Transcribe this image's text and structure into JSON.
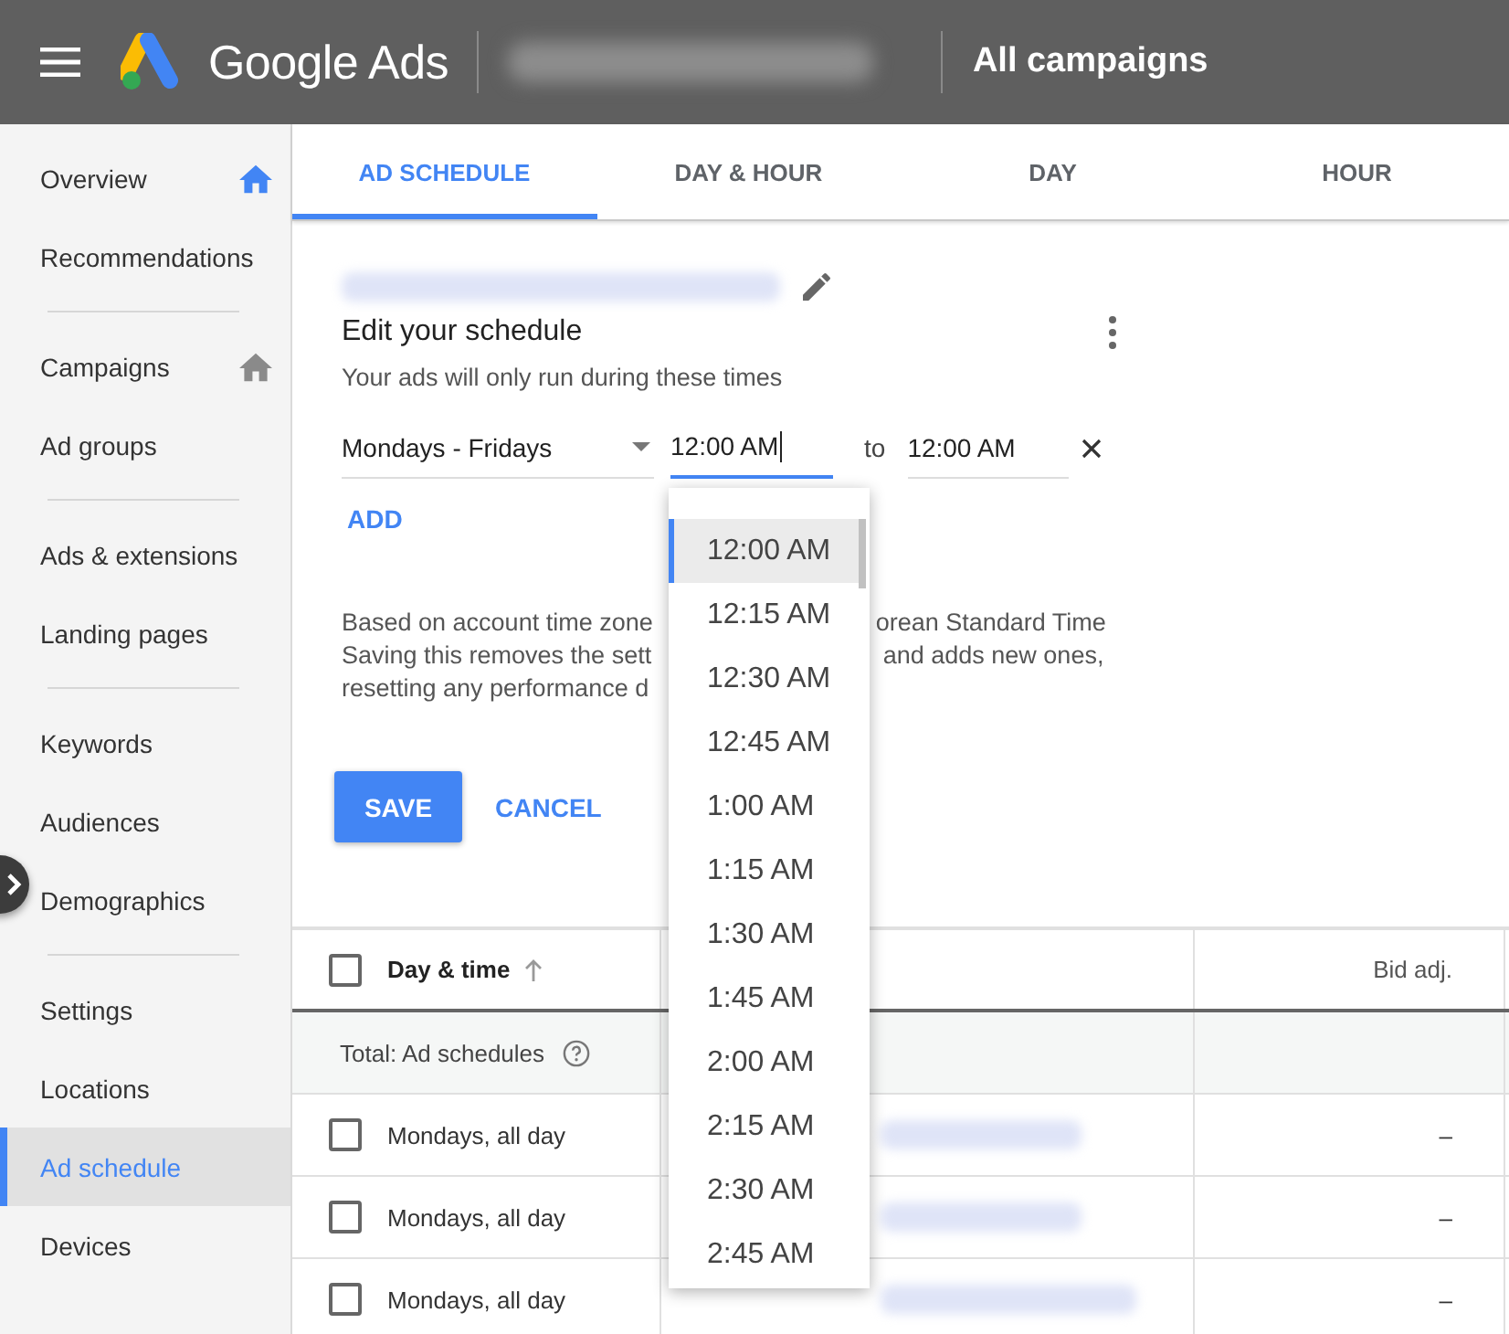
{
  "header": {
    "product": "Google Ads",
    "scope": "All campaigns"
  },
  "sidebar": {
    "groups": [
      {
        "items": [
          {
            "label": "Overview",
            "selected": false,
            "home_icon": true,
            "home_active": true
          },
          {
            "label": "Recommendations",
            "selected": false,
            "home_icon": false
          }
        ]
      },
      {
        "items": [
          {
            "label": "Campaigns",
            "selected": false,
            "home_icon": true,
            "home_active": false
          },
          {
            "label": "Ad groups",
            "selected": false,
            "home_icon": false
          }
        ]
      },
      {
        "items": [
          {
            "label": "Ads & extensions",
            "selected": false
          },
          {
            "label": "Landing pages",
            "selected": false
          }
        ]
      },
      {
        "items": [
          {
            "label": "Keywords",
            "selected": false
          },
          {
            "label": "Audiences",
            "selected": false
          },
          {
            "label": "Demographics",
            "selected": false
          }
        ]
      },
      {
        "items": [
          {
            "label": "Settings",
            "selected": false
          },
          {
            "label": "Locations",
            "selected": false
          },
          {
            "label": "Ad schedule",
            "selected": true
          },
          {
            "label": "Devices",
            "selected": false
          }
        ]
      }
    ]
  },
  "tabs": [
    {
      "label": "AD SCHEDULE",
      "selected": true
    },
    {
      "label": "DAY & HOUR",
      "selected": false
    },
    {
      "label": "DAY",
      "selected": false
    },
    {
      "label": "HOUR",
      "selected": false
    }
  ],
  "editor": {
    "title": "Edit your schedule",
    "subtitle": "Your ads will only run during these times",
    "days": "Mondays - Fridays",
    "start": "12:00 AM",
    "separator": "to",
    "end": "12:00 AM",
    "add": "ADD",
    "note_left": [
      "Based on account time zone",
      "Saving this removes the sett",
      "resetting any performance d"
    ],
    "note_right": [
      "orean Standard Time",
      "and adds new ones,"
    ],
    "save": "SAVE",
    "cancel": "CANCEL"
  },
  "time_menu": {
    "options": [
      {
        "label": "12:00 AM",
        "selected": true
      },
      {
        "label": "12:15 AM",
        "selected": false
      },
      {
        "label": "12:30 AM",
        "selected": false
      },
      {
        "label": "12:45 AM",
        "selected": false
      },
      {
        "label": "1:00 AM",
        "selected": false
      },
      {
        "label": "1:15 AM",
        "selected": false
      },
      {
        "label": "1:30 AM",
        "selected": false
      },
      {
        "label": "1:45 AM",
        "selected": false
      },
      {
        "label": "2:00 AM",
        "selected": false
      },
      {
        "label": "2:15 AM",
        "selected": false
      },
      {
        "label": "2:30 AM",
        "selected": false
      },
      {
        "label": "2:45 AM",
        "selected": false
      }
    ]
  },
  "table": {
    "header_checked": false,
    "columns": [
      "Day & time",
      "Bid adj."
    ],
    "total": "Total: Ad schedules",
    "rows": [
      {
        "checked": false,
        "day_time": "Mondays, all day",
        "bid_adj": "–"
      },
      {
        "checked": false,
        "day_time": "Mondays, all day",
        "bid_adj": "–"
      },
      {
        "checked": false,
        "day_time": "Mondays, all day",
        "bid_adj": "–"
      }
    ]
  }
}
